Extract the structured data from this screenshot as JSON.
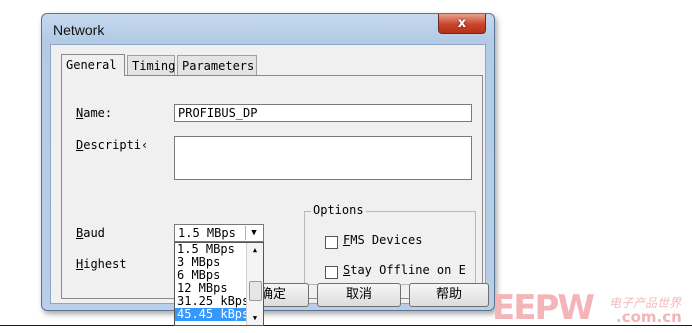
{
  "window": {
    "title": "Network",
    "close_label": "x"
  },
  "tabs": [
    "General",
    "Timing",
    "Parameters"
  ],
  "form": {
    "name_label": "Name:",
    "name_value": "PROFIBUS_DP",
    "description_label": "Descripti‹",
    "description_value": "",
    "baud_label": "Baud",
    "baud_value": "1.5 MBps",
    "highest_label": "Highest"
  },
  "baud_options": [
    "1.5 MBps",
    "3 MBps",
    "6 MBps",
    "12 MBps",
    "31.25 kBps",
    "45.45 kBps"
  ],
  "baud_selected_index": 5,
  "options": {
    "title": "Options",
    "fms_label": "FMS Devices",
    "fms_checked": false,
    "offline_label": "Stay Offline on E",
    "offline_checked": false
  },
  "buttons": {
    "ok": "确定",
    "cancel": "取消",
    "help": "帮助"
  },
  "watermark": {
    "logo": "EEPW",
    "cn": "电子产品世界",
    "url": ".com.cn"
  }
}
